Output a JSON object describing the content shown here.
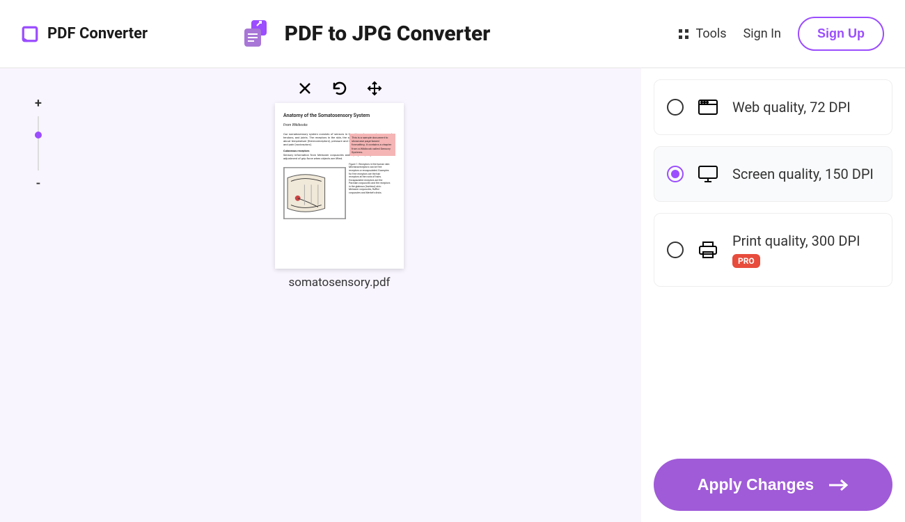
{
  "header": {
    "brand": "PDF Converter",
    "title": "PDF to JPG Converter",
    "tools_label": "Tools",
    "signin_label": "Sign In",
    "signup_label": "Sign Up"
  },
  "zoom": {
    "plus": "+",
    "minus": "-"
  },
  "document": {
    "filename": "somatosensory.pdf",
    "preview": {
      "title": "Anatomy of the Somatosensory System",
      "subtitle": "From Wikibooks"
    },
    "toolbar": [
      "close-icon",
      "rotate-icon",
      "move-icon"
    ]
  },
  "quality_options": [
    {
      "id": "web",
      "label": "Web quality, 72 DPI",
      "icon": "browser-icon",
      "selected": false,
      "pro": false
    },
    {
      "id": "screen",
      "label": "Screen quality, 150 DPI",
      "icon": "monitor-icon",
      "selected": true,
      "pro": false
    },
    {
      "id": "print",
      "label": "Print quality, 300 DPI",
      "icon": "printer-icon",
      "selected": false,
      "pro": true
    }
  ],
  "pro_badge_label": "PRO",
  "apply_label": "Apply Changes",
  "colors": {
    "accent": "#9b4dff",
    "apply": "#a05bd8",
    "pro": "#e74c3c"
  }
}
